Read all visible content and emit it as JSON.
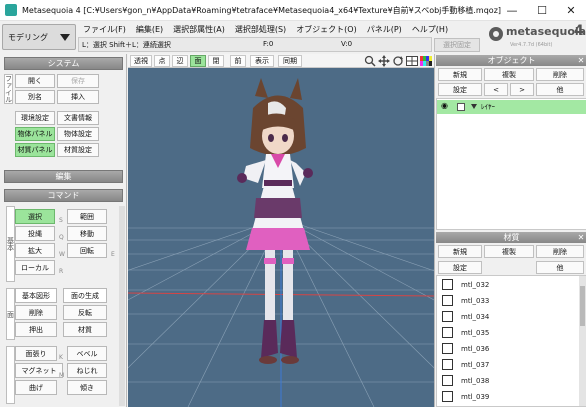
{
  "window": {
    "title": "Metasequoia 4 [C:¥Users¥gon_n¥AppData¥Roaming¥tetraface¥Metasequoia4_x64¥Texture¥自前¥スペobj手動移植.mqoz]",
    "minimize": "—",
    "maximize": "☐",
    "close": "✕"
  },
  "mode_button": "モデリング",
  "menu": [
    "ファイル(F)",
    "編集(E)",
    "選択部属性(A)",
    "選択部処理(S)",
    "オブジェクト(O)",
    "パネル(P)",
    "ヘルプ(H)"
  ],
  "logo": {
    "name": "metasequoia",
    "number": "4",
    "version": "Ver4.7.7d (64bit)"
  },
  "statusbar": {
    "hint": "L：選択  Shift＋L：連続選択",
    "faces": "F:0",
    "verts": "V:0",
    "select_fix": "選択固定"
  },
  "left_panel": {
    "system": {
      "header": "システム",
      "file_label": "ファイル",
      "buttons": [
        "開く",
        "保存",
        "別名",
        "挿入",
        "環境設定",
        "文書情報",
        "物体パネル",
        "物体設定",
        "材質パネル",
        "材質設定"
      ]
    },
    "edit": {
      "header": "編集"
    },
    "command": {
      "header": "コマンド",
      "basic_label": "基本",
      "basic": [
        {
          "label": "選択",
          "key": "S"
        },
        {
          "label": "範囲",
          "key": ""
        },
        {
          "label": "投縄",
          "key": "Q"
        },
        {
          "label": "移動",
          "key": ""
        },
        {
          "label": "拡大",
          "key": "W"
        },
        {
          "label": "回転",
          "key": "E"
        },
        {
          "label": "ローカル",
          "key": "R"
        }
      ],
      "create_label": "面",
      "create": [
        "基本図形",
        "面の生成",
        "削除",
        "反転",
        "押出",
        "材質"
      ],
      "deform": [
        {
          "label": "面張り",
          "key": "K"
        },
        {
          "label": "ベベル",
          "key": ""
        },
        {
          "label": "マグネット",
          "key": "M"
        },
        {
          "label": "ねじれ",
          "key": ""
        },
        {
          "label": "曲げ",
          "key": ""
        },
        {
          "label": "傾き",
          "key": ""
        }
      ]
    }
  },
  "viewport_toolbar": [
    "透視",
    "点",
    "辺",
    "面",
    "閉",
    "前",
    "表示",
    "同期"
  ],
  "viewport_toolbar_active": [
    "面"
  ],
  "objects_panel": {
    "header": "オブジェクト",
    "buttons": [
      "新規",
      "複製",
      "削除",
      "設定",
      "<",
      ">",
      "他"
    ],
    "items": [
      {
        "name": "ﾚｲﾔｰ",
        "visible": "◉"
      }
    ]
  },
  "materials_panel": {
    "header": "材質",
    "buttons": [
      "新規",
      "複製",
      "削除",
      "設定",
      "他"
    ],
    "items": [
      "mtl_032",
      "mtl_033",
      "mtl_034",
      "mtl_035",
      "mtl_036",
      "mtl_037",
      "mtl_038",
      "mtl_039"
    ]
  },
  "colors": {
    "viewport_bg": "#4d6b86",
    "toggle_green": "#9be49b",
    "object_row": "#a3e8a3"
  },
  "icons": [
    "app-icon",
    "zoom-icon",
    "move-view-icon",
    "rotate-view-icon",
    "view-layout-icon",
    "color-palette-icon"
  ]
}
